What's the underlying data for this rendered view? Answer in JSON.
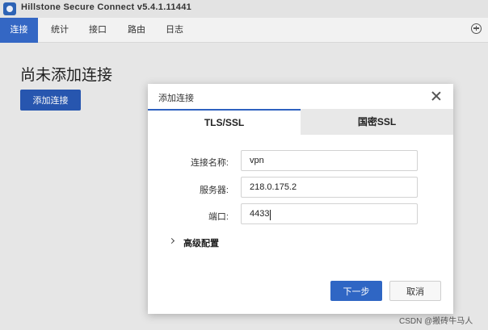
{
  "window": {
    "title": "Hillstone Secure Connect v5.4.1.11441"
  },
  "tabs": [
    {
      "label": "连接",
      "active": true
    },
    {
      "label": "统计",
      "active": false
    },
    {
      "label": "接口",
      "active": false
    },
    {
      "label": "路由",
      "active": false
    },
    {
      "label": "日志",
      "active": false
    }
  ],
  "toolbar": {
    "more_label": ""
  },
  "main": {
    "empty_title": "尚未添加连接",
    "add_button": "添加连接"
  },
  "dialog": {
    "title": "添加连接",
    "tabs": [
      {
        "label": "TLS/SSL",
        "active": true
      },
      {
        "label": "国密SSL",
        "active": false
      }
    ],
    "fields": [
      {
        "label": "连接名称:",
        "value": "vpn"
      },
      {
        "label": "服务器:",
        "value": "218.0.175.2"
      },
      {
        "label": "端口:",
        "value": "4433"
      }
    ],
    "advanced_label": "高级配置",
    "next_button": "下一步",
    "cancel_button": "取消"
  },
  "watermark": "CSDN @搬砖牛马人",
  "colors": {
    "accent": "#2f66c4",
    "tab_active": "#3467c4"
  },
  "icons": [
    "app-logo-icon",
    "add-icon",
    "close-icon",
    "chevron-right-icon"
  ]
}
